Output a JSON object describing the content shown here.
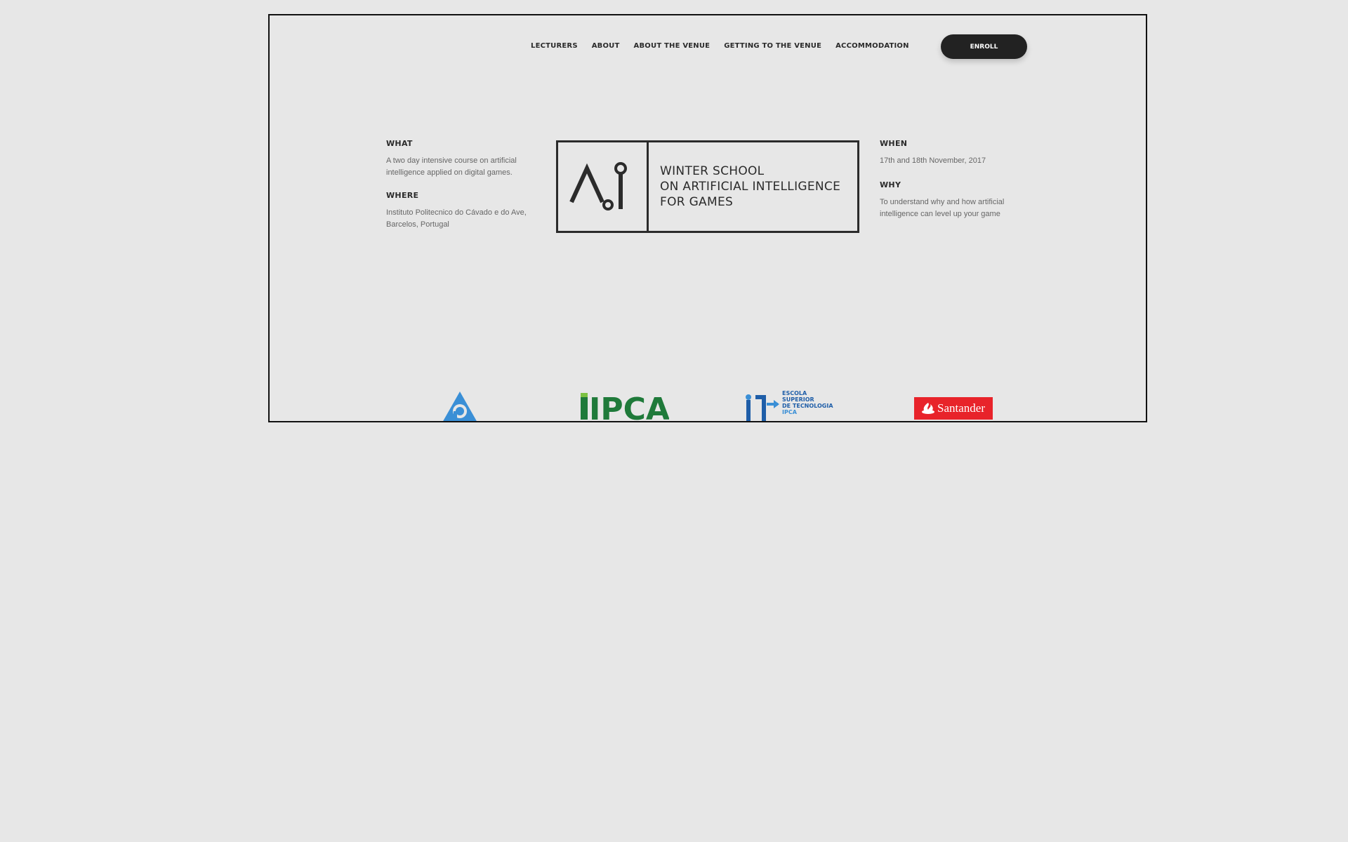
{
  "nav": {
    "items": [
      "LECTURERS",
      "ABOUT",
      "ABOUT THE VENUE",
      "GETTING TO THE VENUE",
      "ACCOMMODATION"
    ],
    "enroll_label": "ENROLL"
  },
  "info": {
    "what": {
      "title": "WHAT",
      "text": "A two day intensive course on artificial intelligence applied on digital games."
    },
    "where": {
      "title": "WHERE",
      "text": "Instituto Politecnico do Cávado e do Ave, Barcelos, Portugal"
    },
    "when": {
      "title": "WHEN",
      "text": "17th and 18th November, 2017"
    },
    "why": {
      "title": "WHY",
      "text": "To understand why and how artificial intelligence can level up your game"
    }
  },
  "logo": {
    "line1": "WINTER SCHOOL",
    "line2": "ON ARTIFICIAL INTELLIGENCE",
    "line3": "FOR GAMES"
  },
  "sponsors": {
    "ipca": "IPCA",
    "escola_line1": "ESCOLA",
    "escola_line2": "SUPERIOR",
    "escola_line3": "DE TECNOLOGIA",
    "escola_line4": "IPCA",
    "santander": "Santander"
  },
  "colors": {
    "background": "#e7e7e7",
    "text": "#2b2b2b",
    "button": "#222222",
    "ipca_green": "#1f7a3a",
    "escola_blue": "#1f5ea8",
    "triangle_blue": "#3a8fd6",
    "santander_red": "#e8232a"
  }
}
